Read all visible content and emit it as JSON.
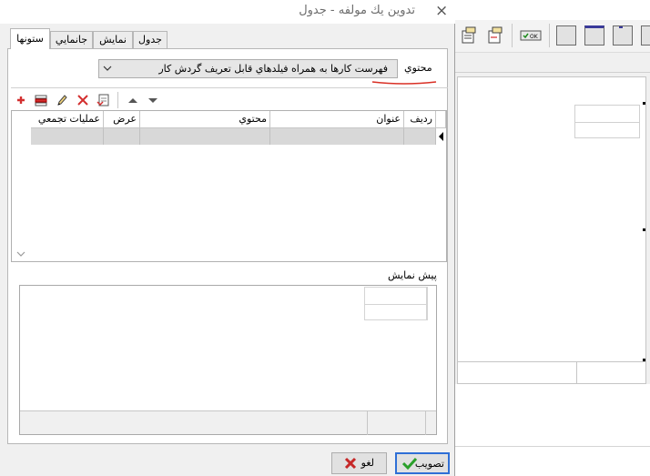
{
  "dialog": {
    "title": "تدوين يك مولفه - جدول",
    "close_label": "×"
  },
  "tabs": [
    {
      "label": "ستونها",
      "active": true
    },
    {
      "label": "جانمايي",
      "active": false
    },
    {
      "label": "نمايش",
      "active": false
    },
    {
      "label": "جدول",
      "active": false
    }
  ],
  "content": {
    "label": "محتوي",
    "selected_value": "فهرست كارها به همراه فيلدهاي قابل تعريف گردش كار"
  },
  "column_toolbar": {
    "icons": [
      "add-icon",
      "insert-row-icon",
      "edit-pencil-icon",
      "delete-icon",
      "remove-row-icon",
      "move-up-icon",
      "move-down-icon"
    ]
  },
  "columns_grid": {
    "headers": {
      "row": "رديف",
      "title": "عنوان",
      "content": "محتوي",
      "width": "عرض",
      "aggregate": "عمليات تجمعي"
    }
  },
  "preview": {
    "label": "پيش نمايش"
  },
  "buttons": {
    "approve": "تصويب",
    "cancel": "لغو"
  },
  "colors": {
    "accent_underline": "#d93025",
    "approve_check": "#2aa02a",
    "cancel_x": "#c62828",
    "focus_border": "#2f6fd6"
  }
}
